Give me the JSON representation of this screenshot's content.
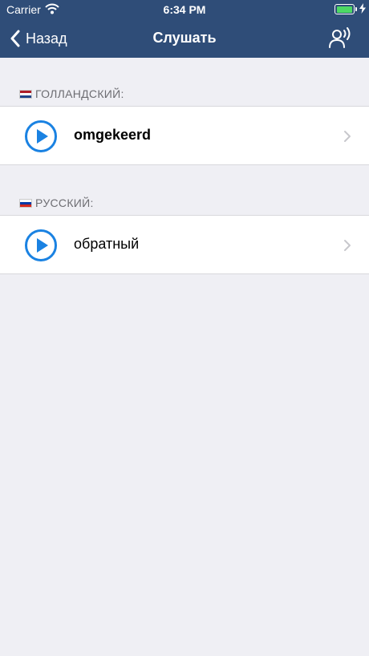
{
  "status_bar": {
    "carrier": "Carrier",
    "time": "6:34 PM"
  },
  "nav": {
    "back_label": "Назад",
    "title": "Слушать"
  },
  "sections": [
    {
      "header": "ГОЛЛАНДСКИЙ:",
      "flag": "nl-flag-icon",
      "word": "omgekeerd"
    },
    {
      "header": "РУССКИЙ:",
      "flag": "ru-flag-icon",
      "word": "обратный"
    }
  ],
  "colors": {
    "nav_background": "#2f4d78",
    "accent_blue": "#1a82e2",
    "page_background": "#efeff4",
    "section_text": "#6d6d72",
    "battery_green": "#4cd964"
  }
}
